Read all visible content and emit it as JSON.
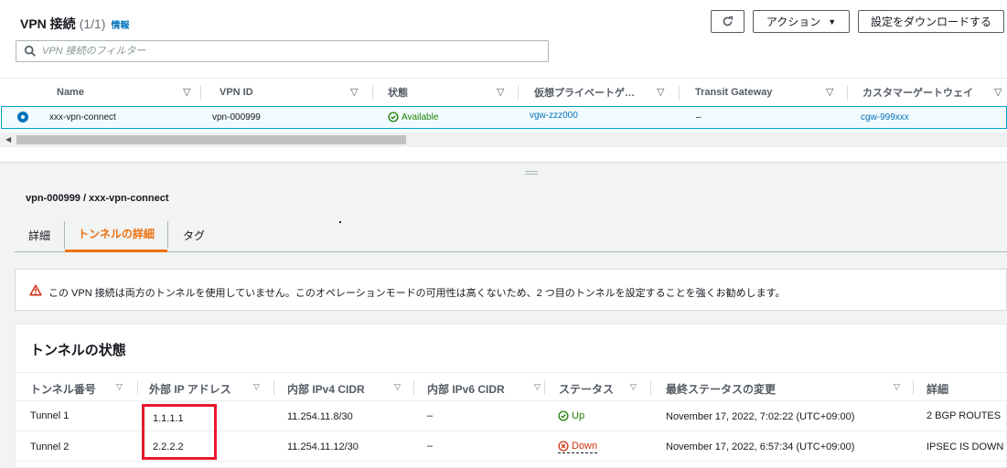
{
  "list": {
    "title": "VPN 接続",
    "count": "(1/1)",
    "info_link": "情報",
    "refresh_icon": "refresh-icon",
    "action_label": "アクション",
    "download_label": "設定をダウンロードする",
    "filter_placeholder": "VPN 接続のフィルター",
    "columns": [
      "Name",
      "VPN ID",
      "状態",
      "仮想プライベートゲ…",
      "Transit Gateway",
      "カスタマーゲートウェイ"
    ],
    "row": {
      "name": "xxx-vpn-connect",
      "vpn_id": "vpn-000999",
      "state": "Available",
      "vgw": "vgw-zzz000",
      "transit_gateway": "–",
      "cgw": "cgw-999xxx"
    }
  },
  "detail": {
    "breadcrumb": "vpn-000999 / xxx-vpn-connect",
    "tabs": [
      "詳細",
      "トンネルの詳細",
      "タグ"
    ],
    "active_tab": "トンネルの詳細",
    "alert": "この VPN 接続は両方のトンネルを使用していません。このオペレーションモードの可用性は高くないため、2 つ目のトンネルを設定することを強くお勧めします。",
    "tunnel_title": "トンネルの状態",
    "tunnel_columns": [
      "トンネル番号",
      "外部 IP アドレス",
      "内部 IPv4 CIDR",
      "内部 IPv6 CIDR",
      "ステータス",
      "最終ステータスの変更",
      "詳細"
    ],
    "tunnels": [
      {
        "number": "Tunnel 1",
        "outside_ip": "1.1.1.1",
        "inside_ipv4": "11.254.11.8/30",
        "inside_ipv6": "–",
        "status": "Up",
        "last_change": "November 17, 2022, 7:02:22 (UTC+09:00)",
        "details": "2 BGP ROUTES"
      },
      {
        "number": "Tunnel 2",
        "outside_ip": "2.2.2.2",
        "inside_ipv4": "11.254.11.12/30",
        "inside_ipv6": "–",
        "status": "Down",
        "last_change": "November 17, 2022, 6:57:34 (UTC+09:00)",
        "details": "IPSEC IS DOWN"
      }
    ]
  },
  "colors": {
    "link": "#0073bb",
    "available": "#1d8102",
    "down": "#d13212",
    "active_tab": "#ec7211",
    "highlight": "#e8192c"
  }
}
